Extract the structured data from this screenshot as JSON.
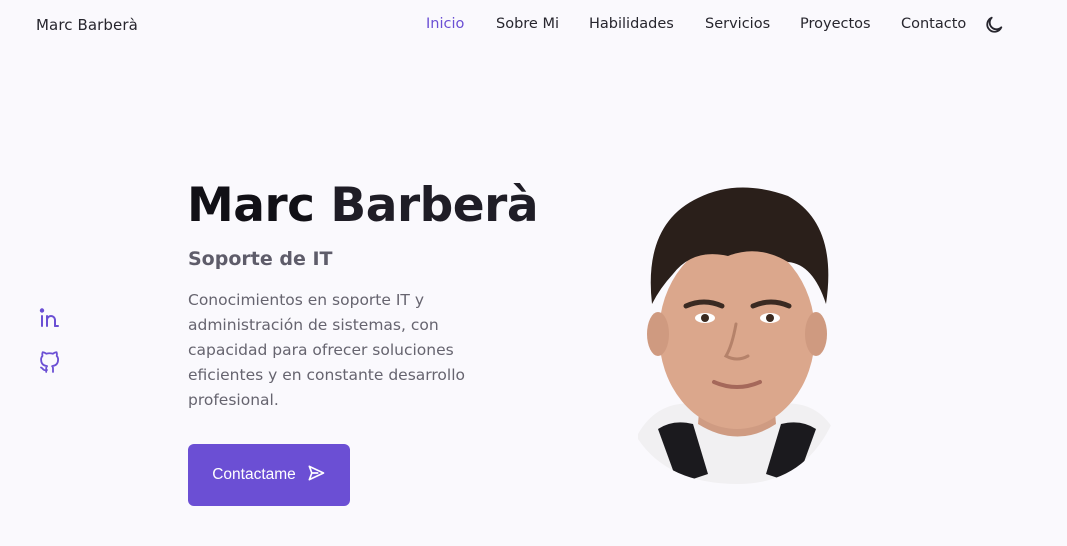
{
  "header": {
    "logo": "Marc Barberà",
    "nav": [
      {
        "label": "Inicio",
        "active": true
      },
      {
        "label": "Sobre Mi",
        "active": false
      },
      {
        "label": "Habilidades",
        "active": false
      },
      {
        "label": "Servicios",
        "active": false
      },
      {
        "label": "Proyectos",
        "active": false
      },
      {
        "label": "Contacto",
        "active": false
      }
    ],
    "theme_toggle_icon": "moon-icon"
  },
  "social": [
    {
      "icon": "linkedin-icon"
    },
    {
      "icon": "github-icon"
    }
  ],
  "hero": {
    "first_name": "Marc",
    "last_name": "Barberà",
    "subtitle": "Soporte de IT",
    "description": "Conocimientos en soporte IT y administración de sistemas, con capacidad para ofrecer soluciones eficientes y en constante desarrollo profesional.",
    "cta_label": "Contactame",
    "cta_icon": "send-icon",
    "portrait_icon": "profile-photo"
  },
  "colors": {
    "accent": "#6b4fd4",
    "background": "#faf9fd",
    "text": "#1d1c22"
  }
}
